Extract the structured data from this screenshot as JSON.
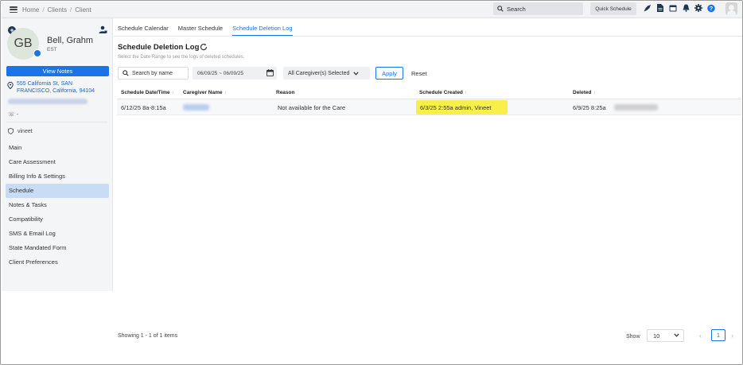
{
  "topbar": {
    "breadcrumb": [
      "Home",
      "Clients",
      "Client"
    ],
    "search_placeholder": "Search",
    "quick_schedule_label": "Quick Schedule",
    "icons": [
      "rocket-icon",
      "document-icon",
      "calendar-icon",
      "bell-icon",
      "gear-icon",
      "help-icon",
      "user-avatar-icon"
    ]
  },
  "sidebar": {
    "initials": "GB",
    "client_name": "Bell, Grahm",
    "timezone": "EST",
    "view_notes_label": "View Notes",
    "address": "555 California St, SAN FRANCISCO, California, 94104",
    "phone": "-",
    "admin": "vineet",
    "nav_items": [
      {
        "label": "Main",
        "active": false
      },
      {
        "label": "Care Assessment",
        "active": false
      },
      {
        "label": "Billing Info & Settings",
        "active": false
      },
      {
        "label": "Schedule",
        "active": true
      },
      {
        "label": "Notes & Tasks",
        "active": false
      },
      {
        "label": "Compatibility",
        "active": false
      },
      {
        "label": "SMS & Email Log",
        "active": false
      },
      {
        "label": "State Mandated Form",
        "active": false
      },
      {
        "label": "Client Preferences",
        "active": false
      }
    ]
  },
  "tabs": [
    {
      "label": "Schedule Calendar",
      "active": false
    },
    {
      "label": "Master Schedule",
      "active": false
    },
    {
      "label": "Schedule Deletion Log",
      "active": true
    }
  ],
  "main": {
    "title": "Schedule Deletion Log",
    "subtitle": "Select the Date Range to see the logs of deleted schedules.",
    "search_placeholder": "Search by name",
    "date_range": "06/09/25 ~ 06/09/25",
    "caregiver_filter": "All Caregiver(s) Selected",
    "apply_label": "Apply",
    "reset_label": "Reset"
  },
  "table": {
    "columns": [
      "Schedule Date/Time",
      "Caregiver Name",
      "Reason",
      "Schedule Created",
      "Deleted"
    ],
    "rows": [
      {
        "date_time": "6/12/25 8a-8:15a",
        "caregiver": "",
        "reason": "Not available for the Care",
        "created": "6/3/25 2:55a admin, Vineet",
        "deleted": "6/9/25 8:25a"
      }
    ]
  },
  "footer": {
    "showing": "Showing 1 - 1 of 1 items",
    "show_label": "Show",
    "page_size": "10",
    "current_page": "1"
  },
  "colors": {
    "accent": "#1a73e8",
    "highlight": "#f8ef4a",
    "sidebar_bg": "#f4f5f7",
    "active_nav": "#c8dcf5"
  }
}
